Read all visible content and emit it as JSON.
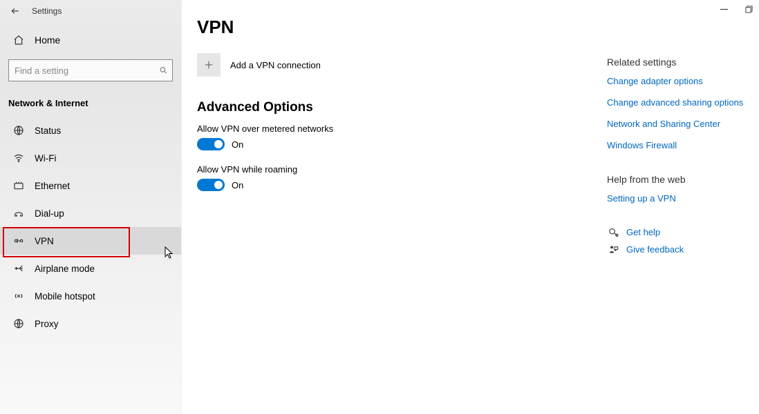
{
  "window": {
    "title": "Settings"
  },
  "sidebar": {
    "home_label": "Home",
    "search_placeholder": "Find a setting",
    "category": "Network & Internet",
    "items": [
      {
        "icon": "status",
        "label": "Status"
      },
      {
        "icon": "wifi",
        "label": "Wi-Fi"
      },
      {
        "icon": "ethernet",
        "label": "Ethernet"
      },
      {
        "icon": "dialup",
        "label": "Dial-up"
      },
      {
        "icon": "vpn",
        "label": "VPN"
      },
      {
        "icon": "airplane",
        "label": "Airplane mode"
      },
      {
        "icon": "hotspot",
        "label": "Mobile hotspot"
      },
      {
        "icon": "proxy",
        "label": "Proxy"
      }
    ]
  },
  "page": {
    "title": "VPN",
    "add_label": "Add a VPN connection",
    "advanced_heading": "Advanced Options",
    "options": [
      {
        "label": "Allow VPN over metered networks",
        "on": true,
        "state": "On"
      },
      {
        "label": "Allow VPN while roaming",
        "on": true,
        "state": "On"
      }
    ]
  },
  "aside": {
    "related_heading": "Related settings",
    "related_links": [
      "Change adapter options",
      "Change advanced sharing options",
      "Network and Sharing Center",
      "Windows Firewall"
    ],
    "help_heading": "Help from the web",
    "help_links": [
      "Setting up a VPN"
    ],
    "footer_links": [
      {
        "icon": "help",
        "label": "Get help"
      },
      {
        "icon": "feedback",
        "label": "Give feedback"
      }
    ]
  }
}
